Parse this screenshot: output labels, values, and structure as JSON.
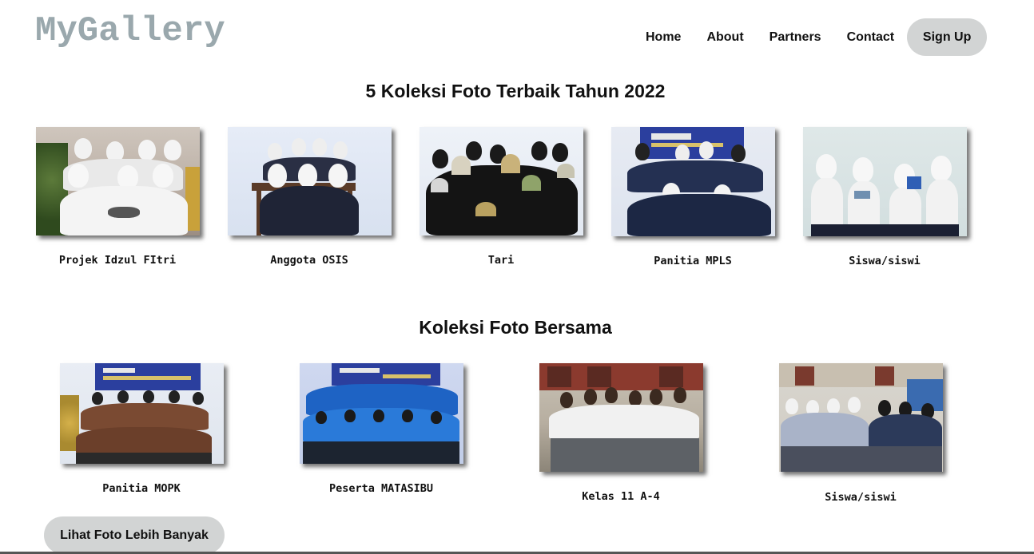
{
  "header": {
    "logo": "MyGallery",
    "nav": [
      "Home",
      "About",
      "Partners",
      "Contact"
    ],
    "signup_label": "Sign Up"
  },
  "section1": {
    "title": "5 Koleksi Foto Terbaik Tahun 2022",
    "items": [
      {
        "caption": "Projek Idzul FItri"
      },
      {
        "caption": "Anggota OSIS"
      },
      {
        "caption": "Tari"
      },
      {
        "caption": "Panitia MPLS"
      },
      {
        "caption": "Siswa/siswi"
      }
    ]
  },
  "section2": {
    "title": "Koleksi Foto Bersama",
    "items": [
      {
        "caption": "Panitia MOPK"
      },
      {
        "caption": "Peserta MATASIBU"
      },
      {
        "caption": "Kelas 11 A-4"
      },
      {
        "caption": "Siswa/siswi"
      }
    ]
  },
  "more_button": "Lihat Foto Lebih Banyak",
  "colors": {
    "logo": "#9aa8ad",
    "button_bg": "#d2d4d4",
    "banner_blue": "#2b3f9e"
  }
}
